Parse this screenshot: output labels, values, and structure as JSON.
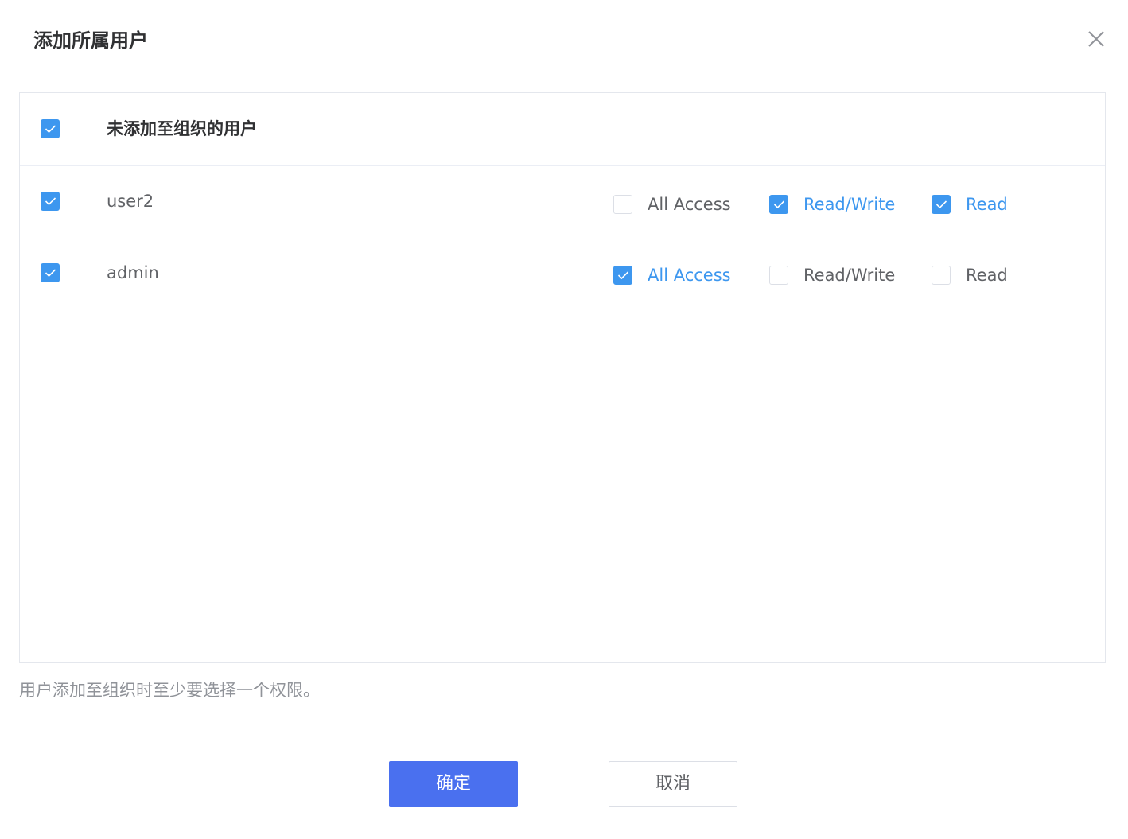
{
  "dialog": {
    "title": "添加所属用户",
    "close_icon": "close-icon"
  },
  "panel": {
    "header": {
      "label": "未添加至组织的用户",
      "checked": true
    },
    "users": [
      {
        "name": "user2",
        "checked": true,
        "permissions": [
          {
            "label": "All Access",
            "checked": false
          },
          {
            "label": "Read/Write",
            "checked": true
          },
          {
            "label": "Read",
            "checked": true
          }
        ]
      },
      {
        "name": "admin",
        "checked": true,
        "permissions": [
          {
            "label": "All Access",
            "checked": true
          },
          {
            "label": "Read/Write",
            "checked": false
          },
          {
            "label": "Read",
            "checked": false
          }
        ]
      }
    ]
  },
  "hint": "用户添加至组织时至少要选择一个权限。",
  "footer": {
    "confirm_label": "确定",
    "cancel_label": "取消"
  },
  "colors": {
    "accent": "#3d97ef",
    "primary_button": "#4a70ef"
  }
}
